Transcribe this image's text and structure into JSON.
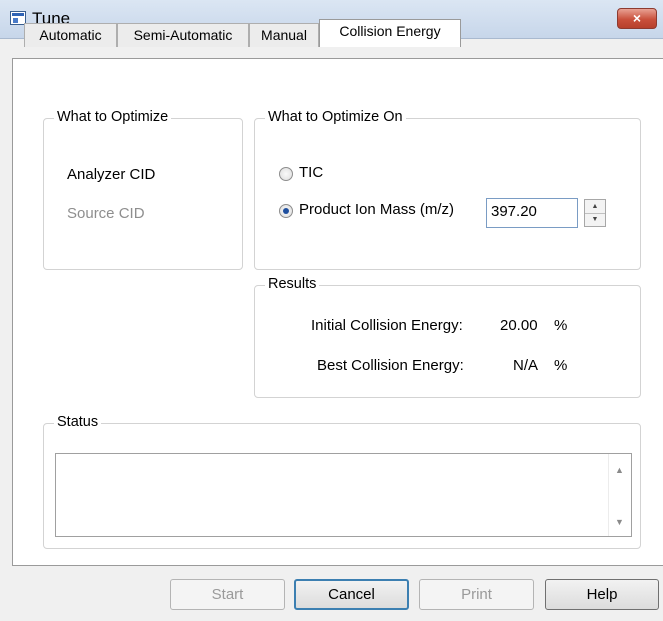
{
  "window": {
    "title": "Tune",
    "close_icon": "×"
  },
  "tabs": [
    {
      "label": "Automatic",
      "active": false
    },
    {
      "label": "Semi-Automatic",
      "active": false
    },
    {
      "label": "Manual",
      "active": false
    },
    {
      "label": "Collision Energy",
      "active": true
    }
  ],
  "optimize": {
    "title": "What to Optimize",
    "analyzer": "Analyzer CID",
    "source": "Source CID"
  },
  "optimize_on": {
    "title": "What to Optimize On",
    "tic_label": "TIC",
    "tic_checked": false,
    "product_label": "Product Ion Mass (m/z)",
    "product_checked": true,
    "mass_value": "397.20",
    "spin_up": "▲",
    "spin_down": "▼"
  },
  "results": {
    "title": "Results",
    "initial_label": "Initial Collision Energy:",
    "initial_value": "20.00",
    "initial_unit": "%",
    "best_label": "Best Collision Energy:",
    "best_value": "N/A",
    "best_unit": "%"
  },
  "status": {
    "title": "Status",
    "text": "",
    "scroll_up": "▲",
    "scroll_down": "▼"
  },
  "buttons": {
    "start": "Start",
    "cancel": "Cancel",
    "print": "Print",
    "help": "Help"
  }
}
